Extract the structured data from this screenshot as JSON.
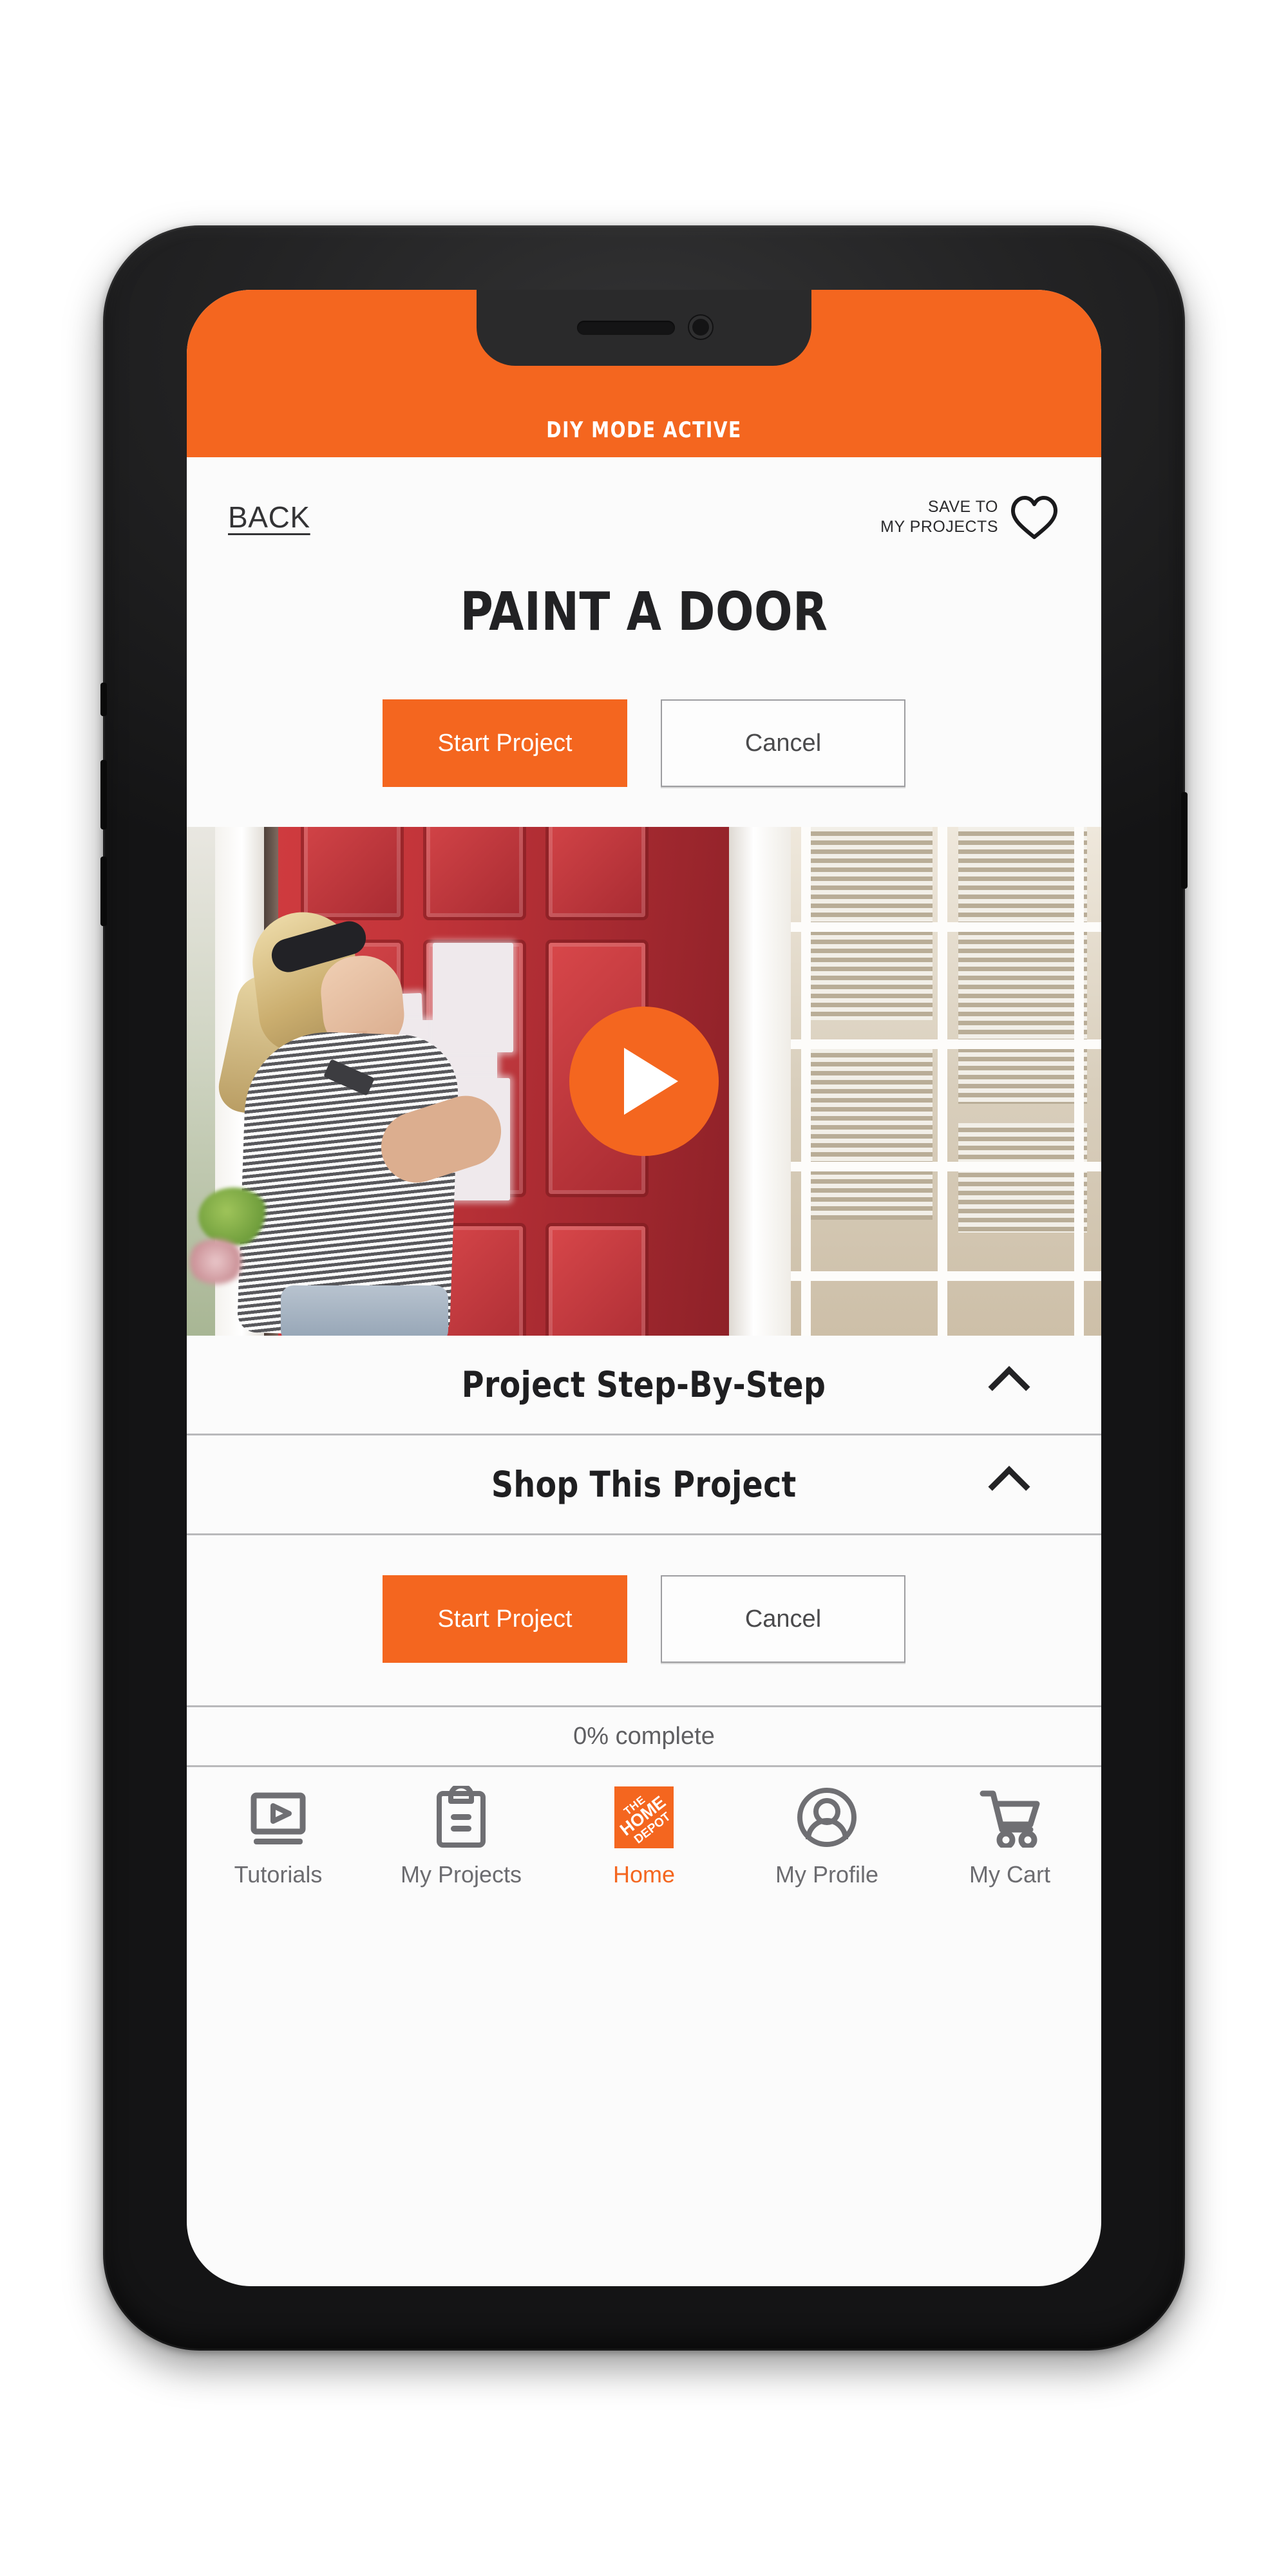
{
  "status_bar": {
    "title": "DIY MODE ACTIVE"
  },
  "topbar": {
    "back_label": "BACK",
    "save_line1": "SAVE TO",
    "save_line2": "MY PROJECTS",
    "heart_icon": "heart-icon"
  },
  "project": {
    "title": "PAINT A DOOR",
    "primary_button": "Start Project",
    "secondary_button": "Cancel",
    "progress": "0% complete"
  },
  "hero": {
    "play_icon": "play-icon",
    "alt": "Woman painting a red front door white"
  },
  "accordions": [
    {
      "label": "Project Step-By-Step",
      "chevron": "chevron-up-icon"
    },
    {
      "label": "Shop This Project",
      "chevron": "chevron-up-icon"
    }
  ],
  "bottom_nav": [
    {
      "label": "Tutorials",
      "icon": "video-player-icon",
      "active": false
    },
    {
      "label": "My Projects",
      "icon": "clipboard-icon",
      "active": false
    },
    {
      "label": "Home",
      "icon": "home-depot-logo-icon",
      "active": true
    },
    {
      "label": "My Profile",
      "icon": "user-circle-icon",
      "active": false
    },
    {
      "label": "My Cart",
      "icon": "shopping-cart-icon",
      "active": false
    }
  ],
  "colors": {
    "brand_orange": "#F4661F",
    "screen_background": "#FBFBFB",
    "text_dark": "#1F1F21",
    "text_muted": "#6C6C70",
    "divider": "#B9B9BB",
    "phone_body": "#232324"
  }
}
